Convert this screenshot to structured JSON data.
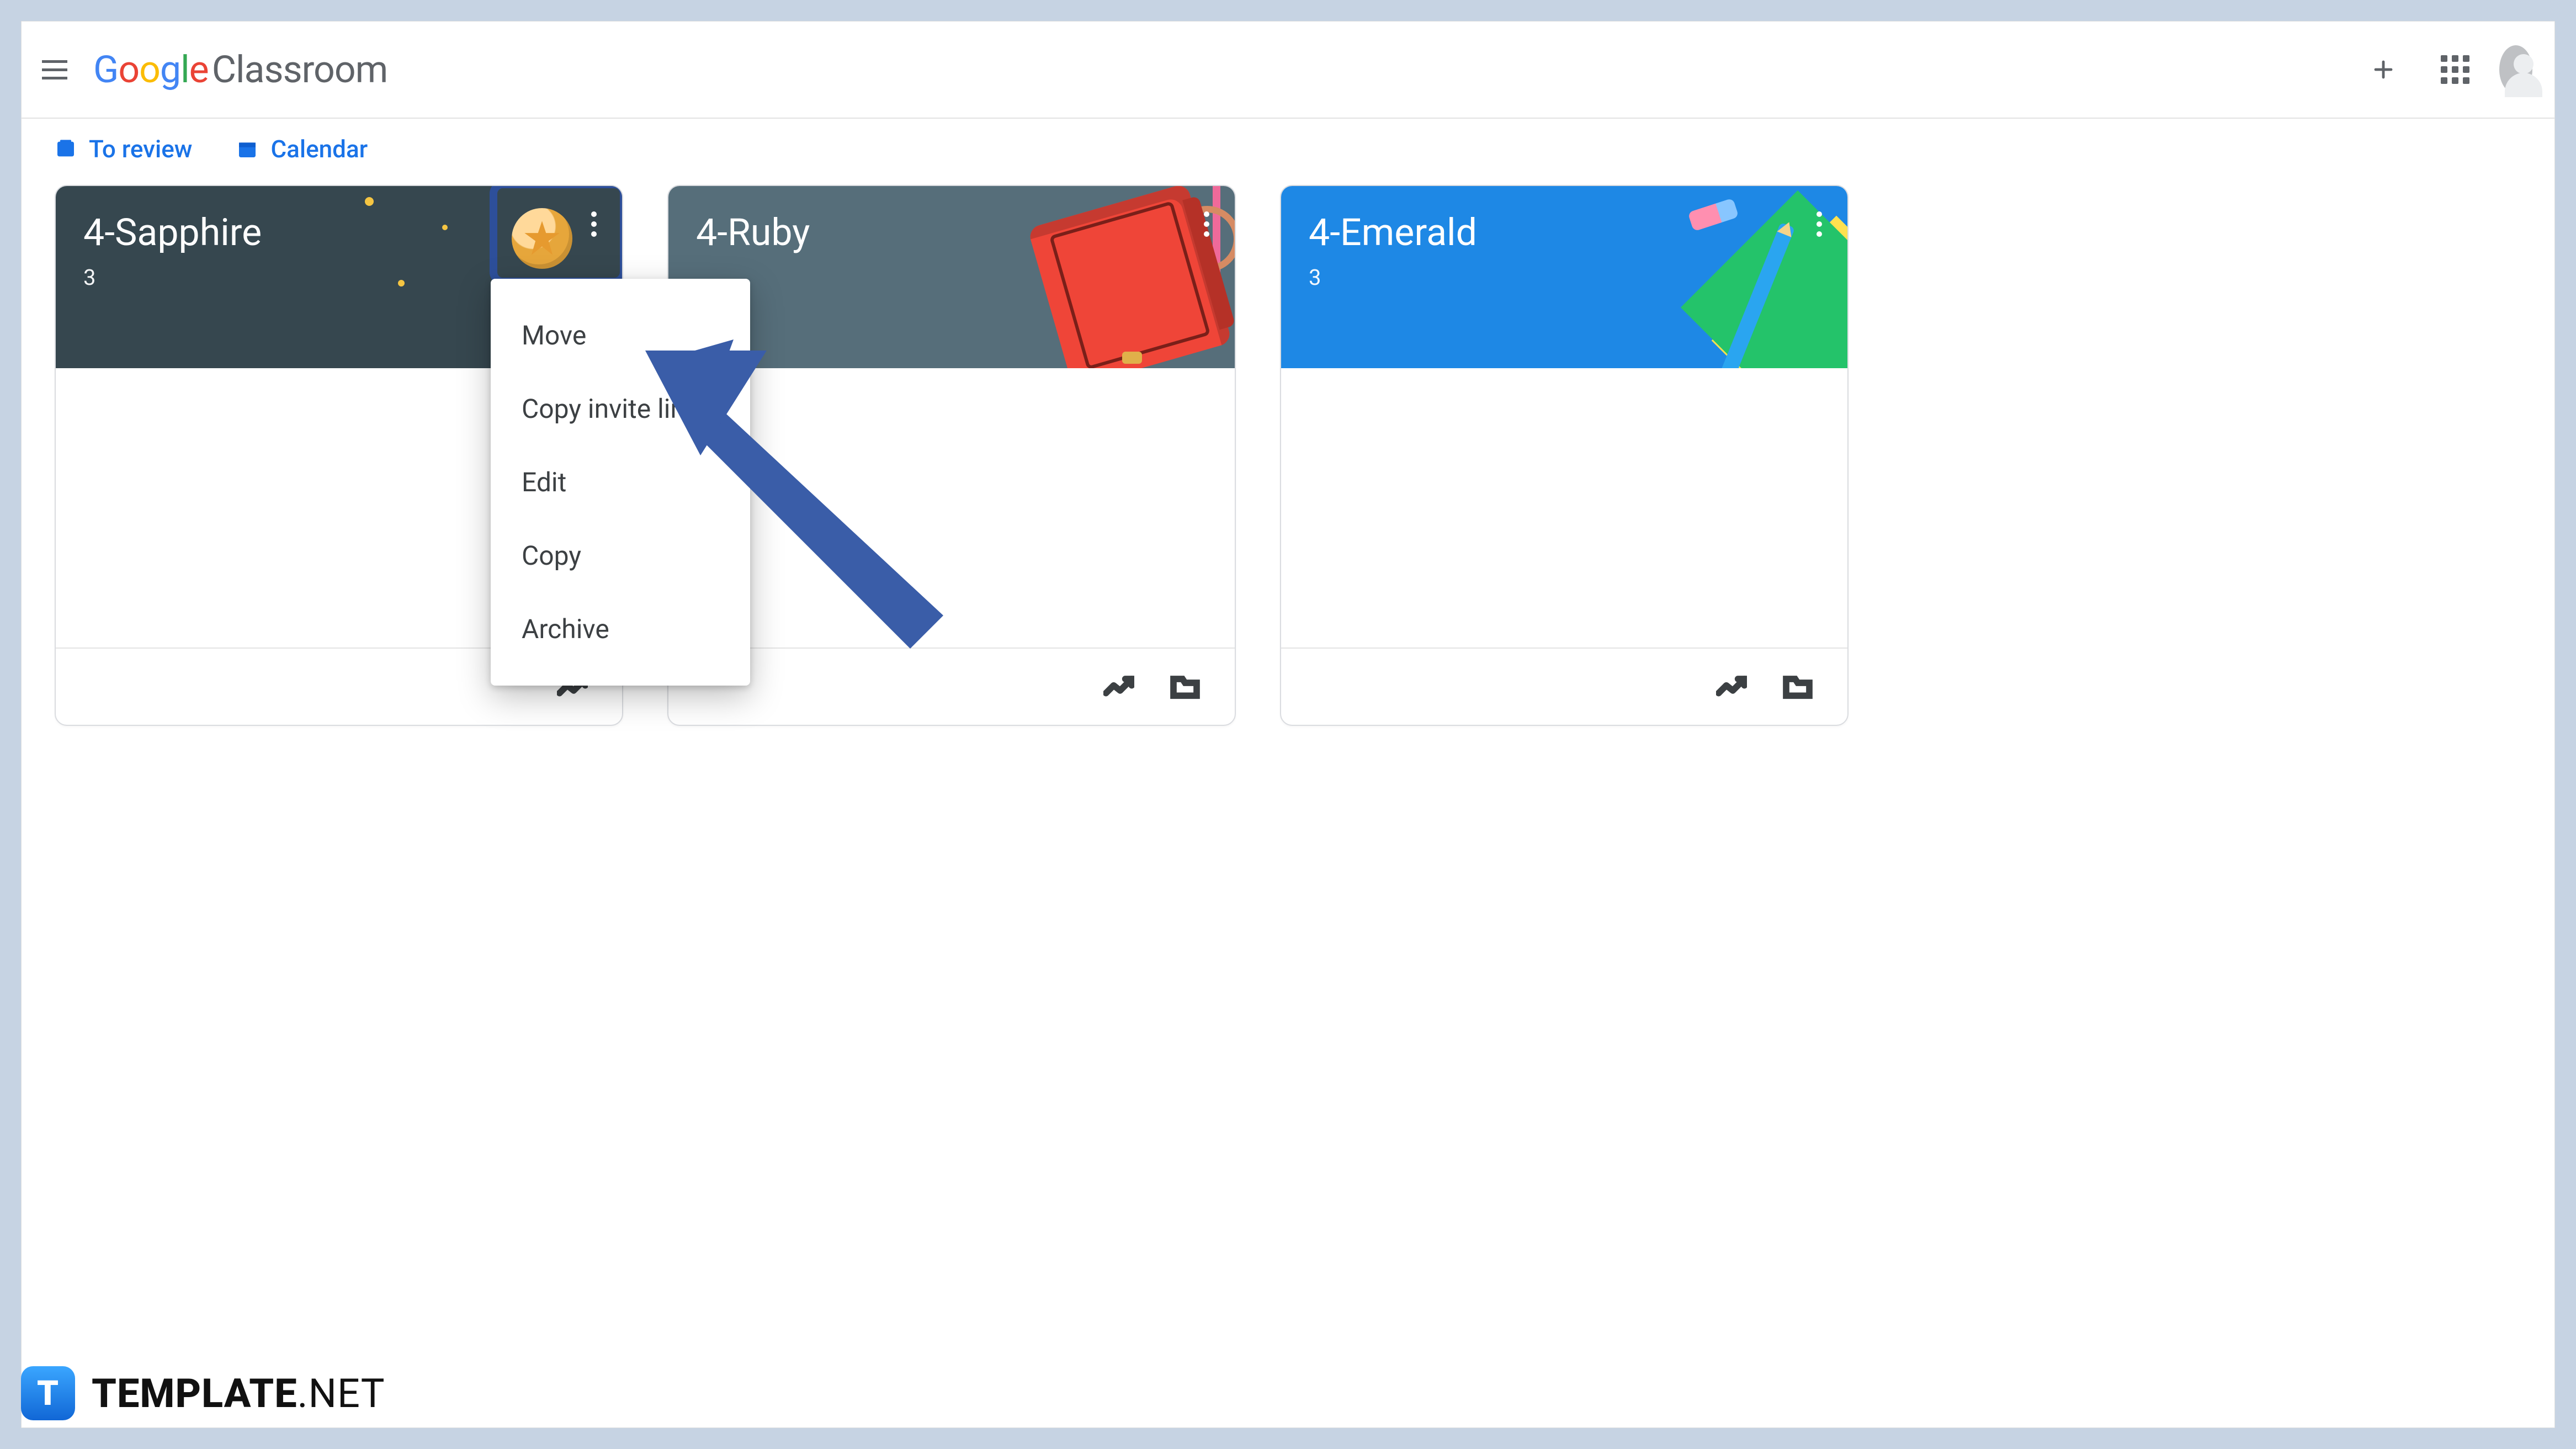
{
  "header": {
    "product_word": "Classroom"
  },
  "subnav": {
    "review": "To review",
    "calendar": "Calendar"
  },
  "cards": [
    {
      "title": "4-Sapphire",
      "subtitle": "3"
    },
    {
      "title": "4-Ruby",
      "subtitle": ""
    },
    {
      "title": "4-Emerald",
      "subtitle": "3"
    }
  ],
  "menu": {
    "items": [
      "Move",
      "Copy invite link",
      "Edit",
      "Copy",
      "Archive"
    ]
  },
  "watermark": {
    "brand": "TEMPLATE",
    "tld": ".NET",
    "badge": "T"
  }
}
